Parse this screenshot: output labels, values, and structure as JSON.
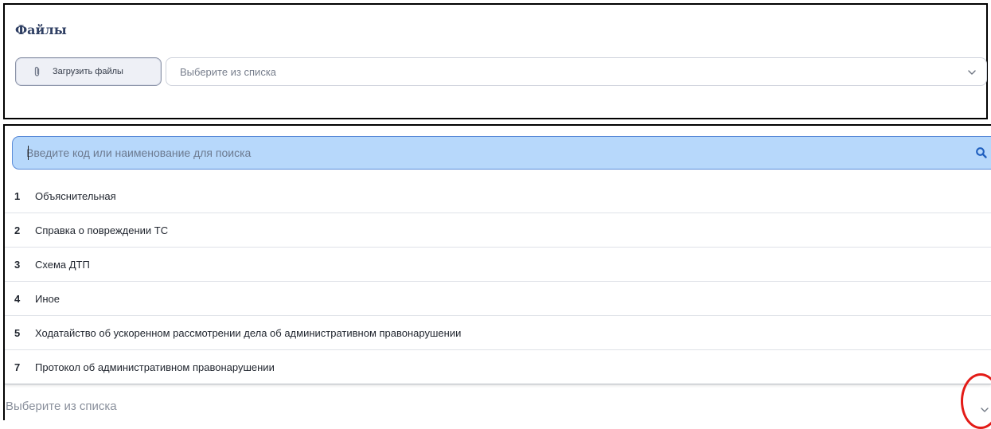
{
  "files": {
    "title": "Файлы",
    "upload_button_label": "Загрузить файлы",
    "upload_icon": "paperclip-icon",
    "select_placeholder": "Выберите из списка",
    "select_icon": "chevron-down-icon"
  },
  "dropdown": {
    "search_placeholder": "Введите код или наименование для поиска",
    "search_icon": "search-icon",
    "options": [
      {
        "code": "1",
        "label": "Объяснительная"
      },
      {
        "code": "2",
        "label": "Справка о повреждении ТС"
      },
      {
        "code": "3",
        "label": "Схема ДТП"
      },
      {
        "code": "4",
        "label": "Иное"
      },
      {
        "code": "5",
        "label": "Ходатайство об ускоренном рассмотрении дела об административном правонарушении"
      },
      {
        "code": "7",
        "label": "Протокол об административном правонарушении"
      }
    ],
    "select_placeholder": "Выберите из списка",
    "select_icon": "chevron-down-icon"
  },
  "colors": {
    "title": "#2f3f63",
    "search_background": "#b7d8fb",
    "search_icon": "#1f5fbf",
    "highlight_circle": "#e31b17"
  }
}
